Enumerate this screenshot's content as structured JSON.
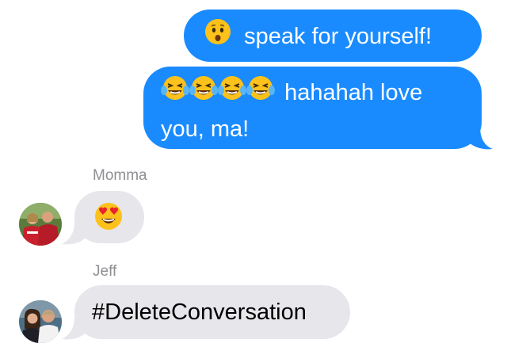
{
  "conversation": {
    "messages": [
      {
        "direction": "outgoing",
        "text": "speak for yourself!",
        "emoji": "worried-face-icon"
      },
      {
        "direction": "outgoing",
        "text_line1": "hahahah love",
        "text_line2": "you, ma!",
        "emoji": "tears-of-joy-icon",
        "emoji_count": 4
      },
      {
        "direction": "incoming",
        "sender": "Momma",
        "emoji": "heart-eyes-icon"
      },
      {
        "direction": "incoming",
        "sender": "Jeff",
        "text": "#DeleteConversation"
      }
    ]
  },
  "colors": {
    "outgoing_bubble": "#1a8bff",
    "incoming_bubble": "#e6e6eb",
    "sender_name": "#8e8e93",
    "emoji_yellow": "#fcc21b"
  }
}
